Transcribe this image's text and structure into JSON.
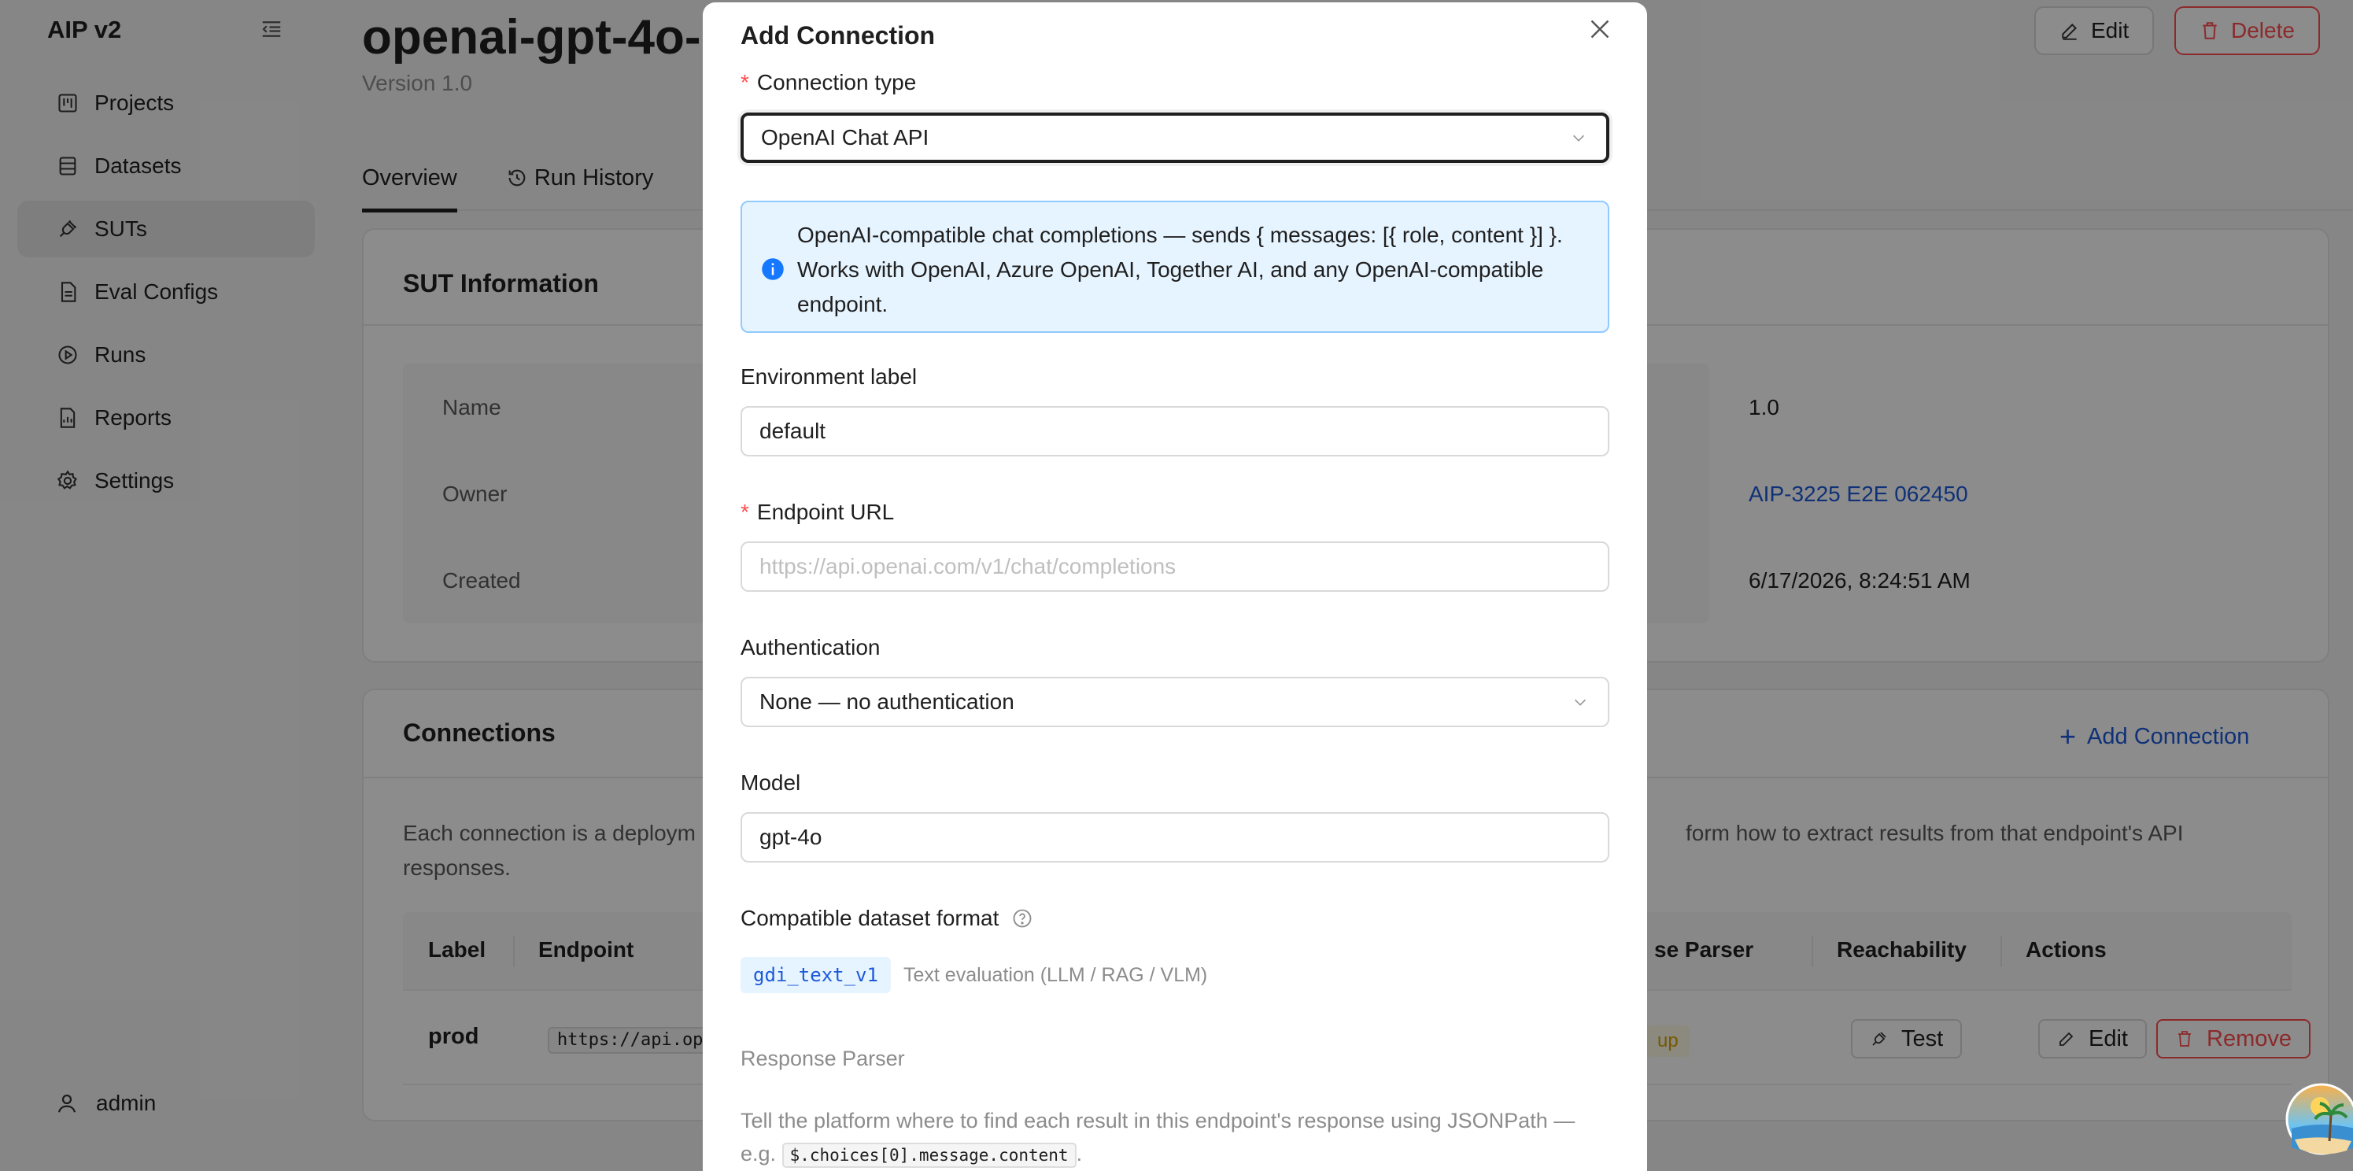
{
  "sidebar": {
    "brand": "AIP v2",
    "items": [
      {
        "label": "Projects"
      },
      {
        "label": "Datasets"
      },
      {
        "label": "SUTs"
      },
      {
        "label": "Eval Configs"
      },
      {
        "label": "Runs"
      },
      {
        "label": "Reports"
      },
      {
        "label": "Settings"
      }
    ],
    "user": "admin"
  },
  "header": {
    "title": "openai-gpt-4o-",
    "version": "Version 1.0",
    "edit_label": "Edit",
    "delete_label": "Delete"
  },
  "tabs": [
    {
      "label": "Overview"
    },
    {
      "label": "Run History"
    }
  ],
  "sut_info": {
    "title": "SUT Information",
    "rows": [
      {
        "label": "Name",
        "value": "1.0"
      },
      {
        "label": "Owner",
        "value": "AIP-3225 E2E 062450"
      },
      {
        "label": "Created",
        "value": "6/17/2026, 8:24:51 AM"
      }
    ]
  },
  "connections": {
    "title": "Connections",
    "add_label": "Add Connection",
    "desc_left": "Each connection is a deploym",
    "desc_right": "form how to extract results from that endpoint's API",
    "desc_line2": "responses.",
    "columns": [
      "Label",
      "Endpoint",
      "se Parser",
      "Reachability",
      "Actions"
    ],
    "row": {
      "label": "prod",
      "endpoint": "https://api.open",
      "parser_badge": "up",
      "test_label": "Test",
      "edit_label": "Edit",
      "remove_label": "Remove"
    }
  },
  "modal": {
    "title": "Add Connection",
    "connection_type_label": "Connection type",
    "connection_type_value": "OpenAI Chat API",
    "info_text": "OpenAI-compatible chat completions — sends { messages: [{ role, content }] }. Works with OpenAI, Azure OpenAI, Together AI, and any OpenAI-compatible endpoint.",
    "env_label": "Environment label",
    "env_value": "default",
    "endpoint_label": "Endpoint URL",
    "endpoint_placeholder": "https://api.openai.com/v1/chat/completions",
    "auth_label": "Authentication",
    "auth_value": "None — no authentication",
    "model_label": "Model",
    "model_value": "gpt-4o",
    "dataset_label": "Compatible dataset format",
    "dataset_chip": "gdi_text_v1",
    "dataset_desc": "Text evaluation (LLM / RAG / VLM)",
    "parser_title": "Response Parser",
    "parser_desc": "Tell the platform where to find each result in this endpoint's response using JSONPath —",
    "parser_eg": "e.g.",
    "parser_code": "$.choices[0].message.content",
    "parser_end": "."
  },
  "colors": {
    "accent": "#1d59d9",
    "danger": "#ff4d4f",
    "info_bg": "#e6f4ff"
  }
}
